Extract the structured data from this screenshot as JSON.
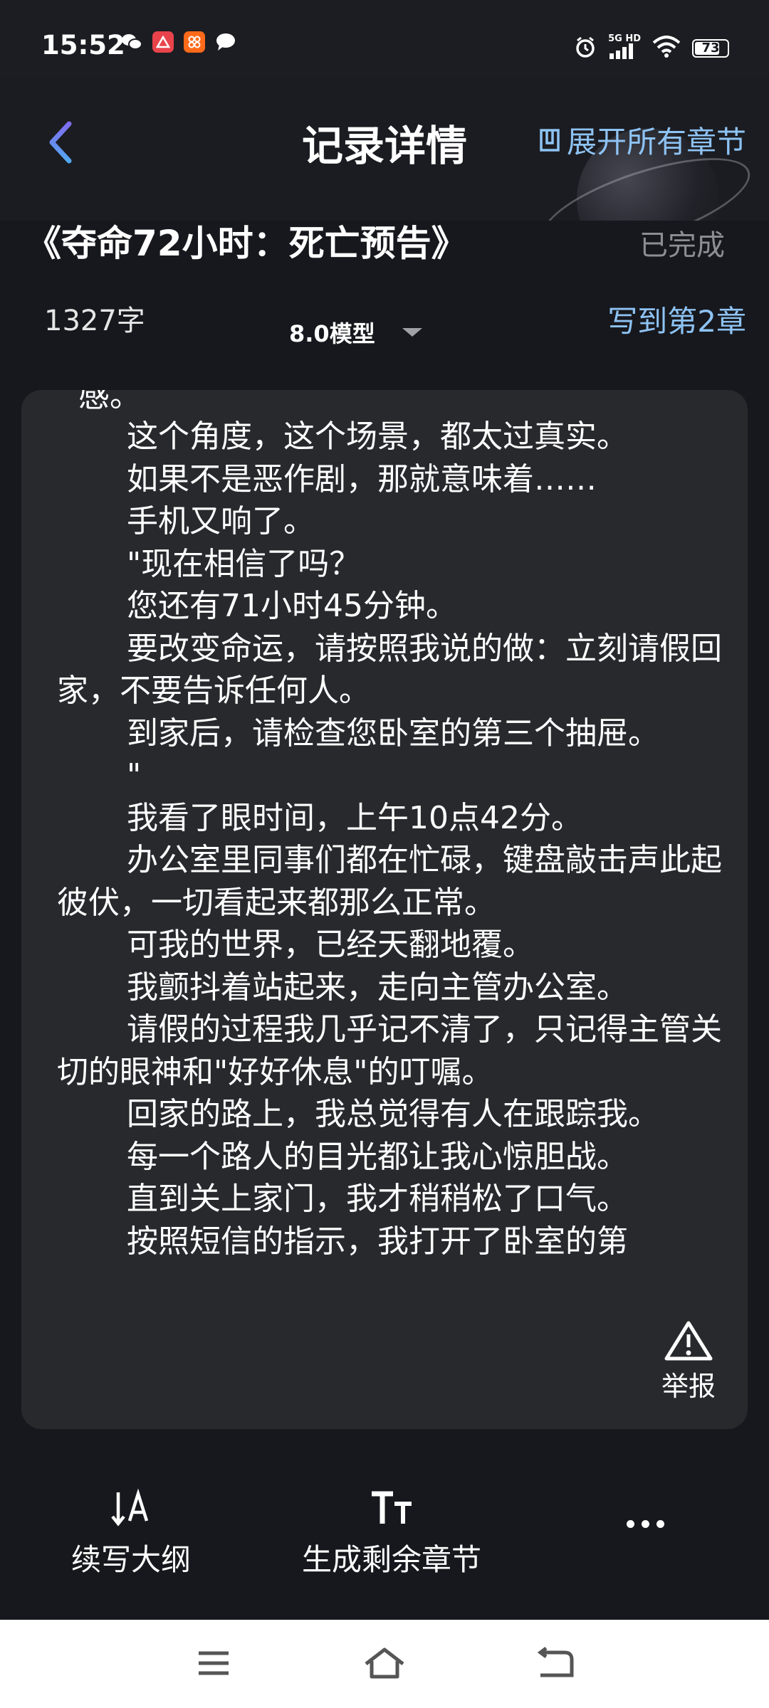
{
  "status_bar": {
    "time": "15:52",
    "network": "5G HD",
    "battery": "73",
    "battery_level_percent": 73
  },
  "header": {
    "title": "记录详情",
    "expand_all_label": "展开所有章节"
  },
  "book": {
    "title": "《夺命72小时：死亡预告》",
    "status": "已完成",
    "word_count": "1327字",
    "model": "8.0模型",
    "progress": "写到第2章"
  },
  "content": {
    "clipped_first_line": "感。",
    "paragraphs": [
      "这个角度，这个场景，都太过真实。",
      "如果不是恶作剧，那就意味着……",
      "手机又响了。",
      "\"现在相信了吗？",
      "您还有71小时45分钟。",
      "要改变命运，请按照我说的做：立刻请假回家，不要告诉任何人。",
      "到家后，请检查您卧室的第三个抽屉。",
      "\"",
      "我看了眼时间，上午10点42分。",
      "办公室里同事们都在忙碌，键盘敲击声此起彼伏，一切看起来都那么正常。",
      "可我的世界，已经天翻地覆。",
      "我颤抖着站起来，走向主管办公室。",
      "请假的过程我几乎记不清了，只记得主管关切的眼神和\"好好休息\"的叮嘱。",
      "回家的路上，我总觉得有人在跟踪我。",
      "每一个路人的目光都让我心惊胆战。",
      "直到关上家门，我才稍稍松了口气。",
      "按照短信的指示，我打开了卧室的第"
    ],
    "report_label": "举报"
  },
  "toolbar": {
    "continue_outline": "续写大纲",
    "generate_remaining": "生成剩余章节",
    "more_icon": "more-dots-icon"
  },
  "colors": {
    "background": "#17181d",
    "card": "#28292d",
    "accent_blue": "#8ec3f4",
    "muted_gray": "#8d8e93"
  }
}
